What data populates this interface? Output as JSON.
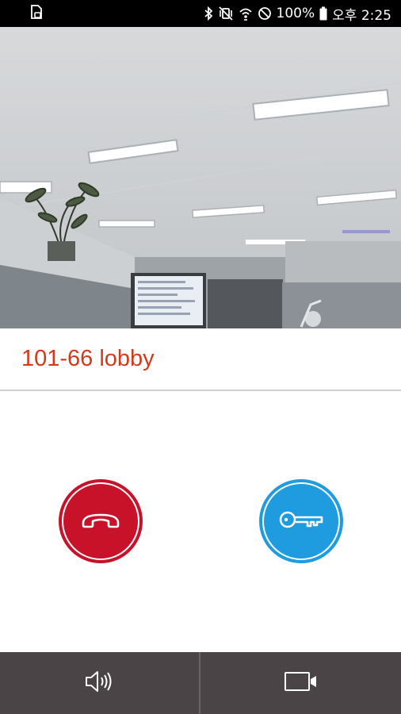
{
  "status_bar": {
    "battery_text": "100%",
    "time_text": "오후 2:25",
    "icons": [
      "sim-card-icon",
      "bluetooth-icon",
      "vibrate-mute-icon",
      "wifi-icon",
      "do-not-disturb-icon",
      "battery-icon"
    ]
  },
  "camera": {
    "description_icon": "camera-feed-image"
  },
  "caller": {
    "label": "101-66 lobby",
    "color": "#d23a1c"
  },
  "actions": {
    "hangup_color": "#c8122a",
    "unlock_color": "#1f9be0",
    "hangup_icon": "phone-hangup-icon",
    "unlock_icon": "key-icon"
  },
  "bottom_bar": {
    "background": "#4b4446",
    "left_icon": "speaker-icon",
    "right_icon": "video-camera-icon"
  }
}
